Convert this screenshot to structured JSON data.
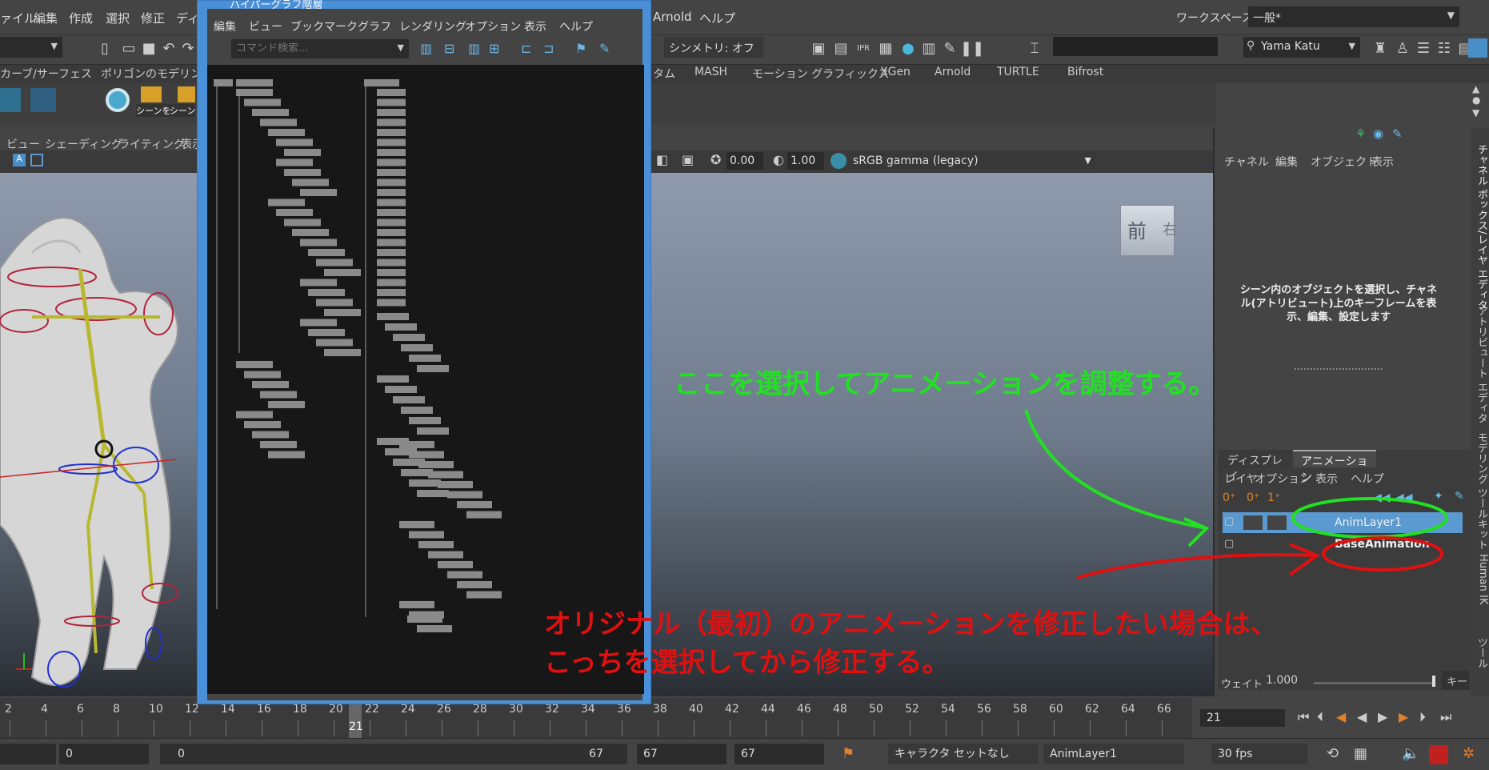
{
  "menubar": {
    "left_items": [
      "ァイル",
      "編集",
      "作成",
      "選択",
      "修正",
      "ディ"
    ],
    "right_items": [
      "Arnold",
      "ヘルプ"
    ],
    "workspace_label": "ワークスペース:",
    "workspace_value": "一般*"
  },
  "toolbar": {
    "symmetry": "シンメトリ: オフ",
    "user": "Yama Katu"
  },
  "shelf_tabs": [
    "カーブ/サーフェス",
    "ポリゴンのモデリング",
    "タム",
    "MASH",
    "モーション グラフィックス",
    "XGen",
    "Arnold",
    "TURTLE",
    "Bifrost"
  ],
  "shelf_items": [
    "シーンを",
    "シーン"
  ],
  "viewport": {
    "menu": [
      "ビュー",
      "シェーディング",
      "ライティング",
      "表示"
    ],
    "exposure": "0.00",
    "gamma": "1.00",
    "colorspace": "sRGB gamma (legacy)",
    "viewcube_front": "前",
    "viewcube_right": "右"
  },
  "hypergraph": {
    "title": "ハイパーグラフ階層",
    "menu": [
      "編集",
      "ビュー",
      "ブックマーク",
      "グラフ",
      "レンダリング",
      "オプション",
      "表示",
      "ヘルプ"
    ],
    "search_placeholder": "コマンド検索..."
  },
  "channel_box": {
    "menu": [
      "チャネル",
      "編集",
      "オブジェクト",
      "表示"
    ],
    "message": "シーン内のオブジェクトを選択し、チャネル(アトリビュート)上のキーフレームを表示、編集、設定します"
  },
  "layer_editor": {
    "tabs": [
      "ディスプレイ",
      "アニメーション"
    ],
    "menu": [
      "レイヤ",
      "オプション",
      "表示",
      "ヘルプ"
    ],
    "layers": [
      "AnimLayer1",
      "BaseAnimation"
    ],
    "weight_label": "ウェイト",
    "weight_value": "1.000",
    "key_label": "キー"
  },
  "side_tabs": [
    "チャネル ボックス/レイヤ エディタ",
    "アトリビュート エディタ",
    "モデリング ツールキット",
    "Human IK",
    "ツール"
  ],
  "timeline": {
    "ticks": [
      "2",
      "4",
      "6",
      "8",
      "10",
      "12",
      "14",
      "16",
      "18",
      "20",
      "22",
      "24",
      "26",
      "28",
      "30",
      "32",
      "34",
      "36",
      "38",
      "40",
      "42",
      "44",
      "46",
      "48",
      "50",
      "52",
      "54",
      "56",
      "58",
      "60",
      "62",
      "64",
      "66"
    ],
    "current_frame": "21",
    "frame_field": "21"
  },
  "range": {
    "start_outer": "0",
    "start_inner": "0",
    "end_inner": "67",
    "end_field": "67",
    "end_outer": "67",
    "character": "キャラクタ セットなし",
    "anim_layer": "AnimLayer1",
    "fps": "30 fps"
  },
  "annotations": {
    "green_text": "ここを選択してアニメーションを調整する。",
    "red_text_1": "オリジナル（最初）のアニメーションを修正したい場合は、",
    "red_text_2": "こっちを選択してから修正する。",
    "green_color": "#22e022",
    "red_color": "#e01010"
  }
}
